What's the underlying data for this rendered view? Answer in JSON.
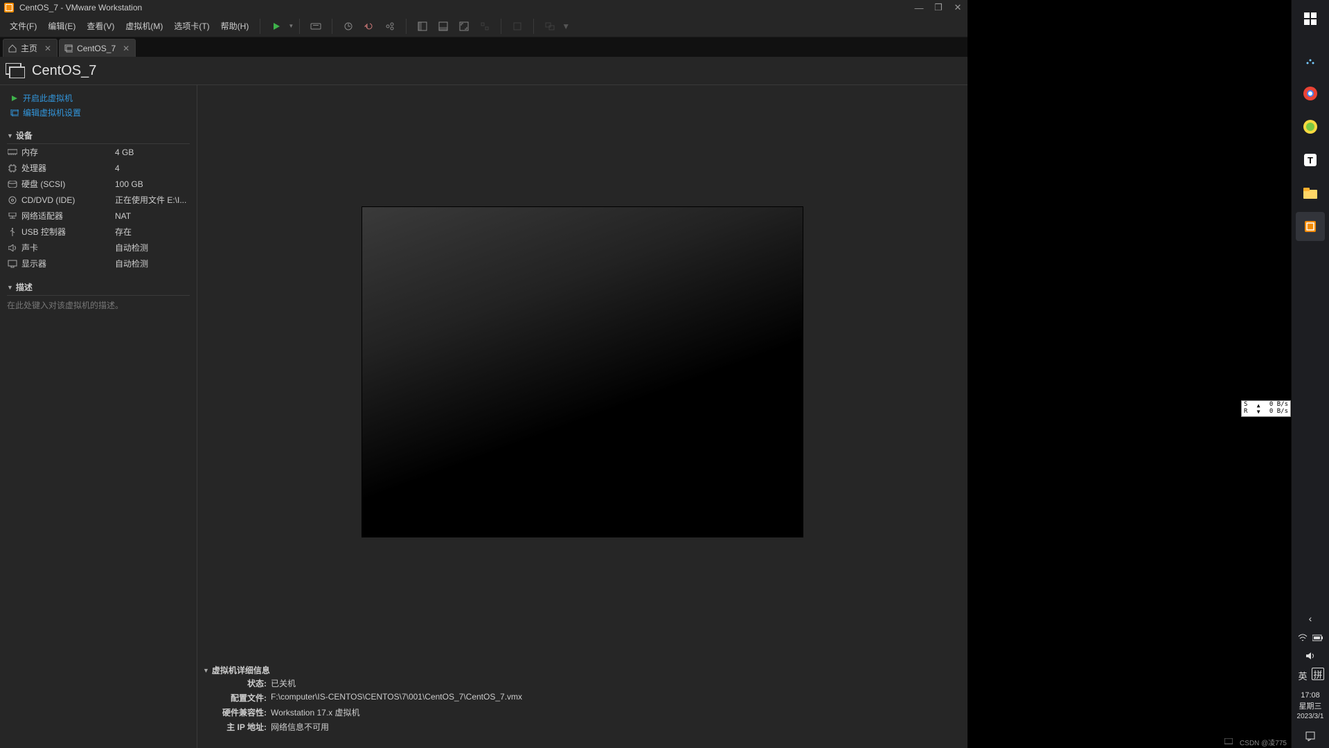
{
  "titlebar": {
    "title": "CentOS_7 - VMware Workstation"
  },
  "menu": {
    "file": "文件(F)",
    "edit": "编辑(E)",
    "view": "查看(V)",
    "vm": "虚拟机(M)",
    "tabs": "选项卡(T)",
    "help": "帮助(H)"
  },
  "tabs": {
    "home": "主页",
    "vm": "CentOS_7"
  },
  "vm_title": "CentOS_7",
  "actions": {
    "power_on": "开启此虚拟机",
    "edit_settings": "编辑虚拟机设置"
  },
  "sections": {
    "devices": "设备",
    "description": "描述",
    "details": "虚拟机详细信息"
  },
  "description_placeholder": "在此处键入对该虚拟机的描述。",
  "devices": [
    {
      "label": "内存",
      "value": "4 GB",
      "icon": "memory"
    },
    {
      "label": "处理器",
      "value": "4",
      "icon": "cpu"
    },
    {
      "label": "硬盘 (SCSI)",
      "value": "100 GB",
      "icon": "disk"
    },
    {
      "label": "CD/DVD (IDE)",
      "value": "正在使用文件 E:\\I...",
      "icon": "cd"
    },
    {
      "label": "网络适配器",
      "value": "NAT",
      "icon": "net"
    },
    {
      "label": "USB 控制器",
      "value": "存在",
      "icon": "usb"
    },
    {
      "label": "声卡",
      "value": "自动检测",
      "icon": "sound"
    },
    {
      "label": "显示器",
      "value": "自动检测",
      "icon": "display"
    }
  ],
  "details": {
    "state_label": "状态:",
    "state": "已关机",
    "config_label": "配置文件:",
    "config": "F:\\computer\\IS-CENTOS\\CENTOS\\7\\001\\CentOS_7\\CentOS_7.vmx",
    "compat_label": "硬件兼容性:",
    "compat": "Workstation 17.x 虚拟机",
    "ip_label": "主 IP 地址:",
    "ip": "网络信息不可用"
  },
  "netmon": {
    "s": "S",
    "r": "R",
    "up": "0 B/s",
    "down": "0 B/s"
  },
  "system": {
    "ime1": "英",
    "ime2": "拼",
    "time": "17:08",
    "weekday": "星期三",
    "date": "2023/3/1"
  },
  "watermark": "CSDN @凌775"
}
